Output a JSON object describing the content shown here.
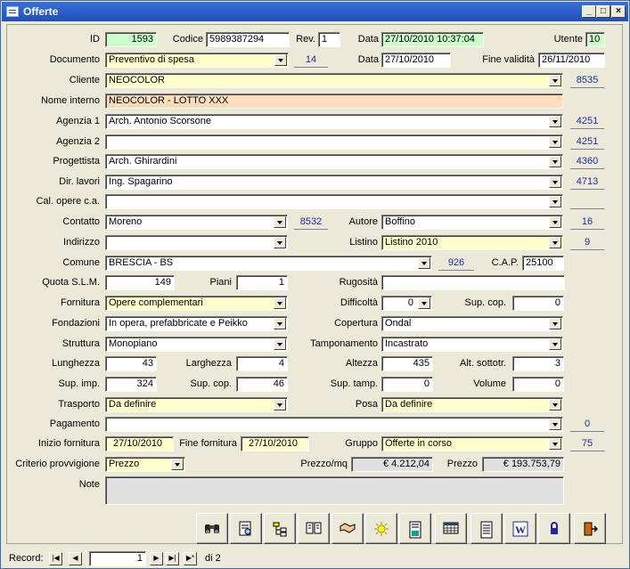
{
  "window": {
    "title": "Offerte"
  },
  "form": {
    "id_label": "ID",
    "id": "1593",
    "codice_label": "Codice",
    "codice": "5989387294",
    "rev_label": "Rev.",
    "rev": "1",
    "data_label": "Data",
    "data": "27/10/2010 10:37:04",
    "utente_label": "Utente",
    "utente": "10",
    "documento_label": "Documento",
    "documento": "Preventivo di spesa",
    "documento_code": "14",
    "data2_label": "Data",
    "data2": "27/10/2010",
    "fine_label": "Fine validità",
    "fine": "26/11/2010",
    "cliente_label": "Cliente",
    "cliente": "NEOCOLOR",
    "cliente_code": "8535",
    "nome_label": "Nome interno",
    "nome": "NEOCOLOR - LOTTO XXX",
    "agenzia1_label": "Agenzia 1",
    "agenzia1": "Arch. Antonio Scorsone",
    "agenzia1_code": "4251",
    "agenzia2_label": "Agenzia 2",
    "agenzia2": "",
    "agenzia2_code": "4251",
    "progettista_label": "Progettista",
    "progettista": "Arch. Ghirardini",
    "progettista_code": "4360",
    "dirlavori_label": "Dir. lavori",
    "dirlavori": "Ing.  Spagarino",
    "dirlavori_code": "4713",
    "calopere_label": "Cal. opere c.a.",
    "calopere": "",
    "contatto_label": "Contatto",
    "contatto": "Moreno",
    "contatto_code": "8532",
    "autore_label": "Autore",
    "autore": "Boffino",
    "autore_code": "16",
    "indirizzo_label": "Indirizzo",
    "indirizzo": "",
    "listino_label": "Listino",
    "listino": "Listino 2010",
    "listino_code": "9",
    "comune_label": "Comune",
    "comune": "BRESCIA - BS",
    "comune_code": "926",
    "cap_label": "C.A.P.",
    "cap": "25100",
    "quota_label": "Quota S.L.M.",
    "quota": "149",
    "piani_label": "Piani",
    "piani": "1",
    "rugosita_label": "Rugosità",
    "rugosita": "",
    "fornitura_label": "Fornitura",
    "fornitura": "Opere complementari",
    "difficolta_label": "Difficoltà",
    "difficolta": "0",
    "supcop1_label": "Sup. cop.",
    "supcop1": "0",
    "fondazioni_label": "Fondazioni",
    "fondazioni": "In opera, prefabbricate e Peikko",
    "copertura_label": "Copertura",
    "copertura": "Ondal",
    "struttura_label": "Struttura",
    "struttura": "Monopiano",
    "tamponamento_label": "Tamponamento",
    "tamponamento": "Incastrato",
    "lunghezza_label": "Lunghezza",
    "lunghezza": "43",
    "larghezza_label": "Larghezza",
    "larghezza": "4",
    "altezza_label": "Altezza",
    "altezza": "435",
    "altsottotr_label": "Alt. sottotr.",
    "altsottotr": "3",
    "supimp_label": "Sup. imp.",
    "supimp": "324",
    "supcop2_label": "Sup. cop.",
    "supcop2": "46",
    "suptamp_label": "Sup. tamp.",
    "suptamp": "0",
    "volume_label": "Volume",
    "volume": "0",
    "trasporto_label": "Trasporto",
    "trasporto": "Da definire",
    "posa_label": "Posa",
    "posa": "Da definire",
    "pagamento_label": "Pagamento",
    "pagamento": "",
    "pagamento_code": "0",
    "inizio_label": "Inizio fornitura",
    "inizio": "27/10/2010",
    "finefor_label": "Fine fornitura",
    "finefor": "27/10/2010",
    "gruppo_label": "Gruppo",
    "gruppo": "Offerte in corso",
    "gruppo_code": "75",
    "criterio_label": "Criterio provvigione",
    "criterio": "Prezzo",
    "prezzomq_label": "Prezzo/mq",
    "prezzomq": "€ 4.212,04",
    "prezzo_label": "Prezzo",
    "prezzo": "€ 193.753,79",
    "note_label": "Note",
    "note": ""
  },
  "toolbar": [
    "binoculars-icon",
    "preview-icon",
    "tree-icon",
    "book-icon",
    "handshake-icon",
    "sun-icon",
    "report-icon",
    "calendar-icon",
    "document-icon",
    "word-icon",
    "lock-icon",
    "exit-icon"
  ],
  "status": {
    "record_label": "Record:",
    "record": "1",
    "of": "di 2"
  }
}
